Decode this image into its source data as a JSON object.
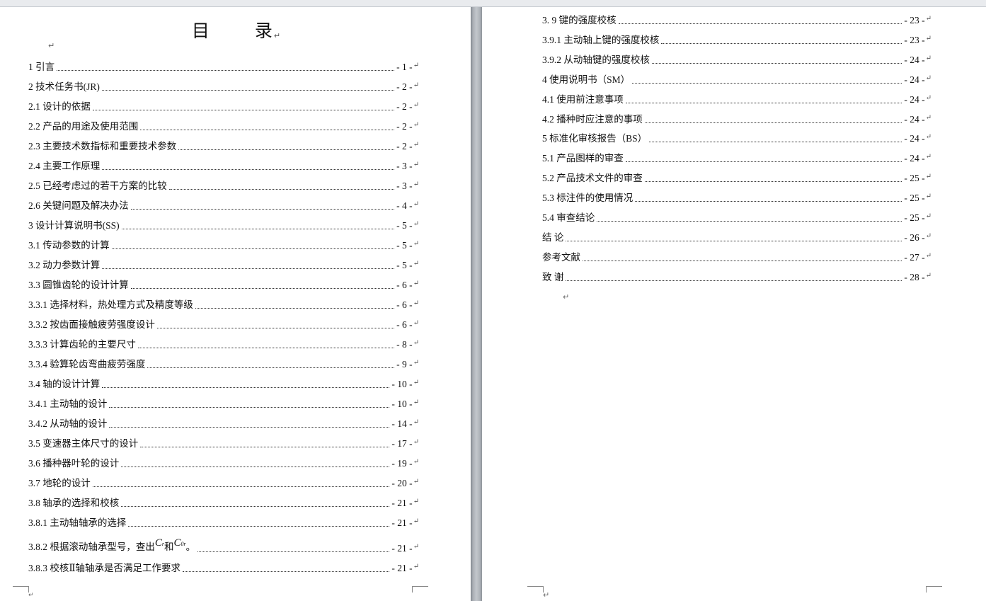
{
  "left_page": {
    "title": "目 录",
    "entries": [
      {
        "label": "1  引言",
        "page": "- 1 -"
      },
      {
        "label": "2  技术任务书(JR)",
        "page": "- 2 -"
      },
      {
        "label": "2.1  设计的依据",
        "page": "- 2 -"
      },
      {
        "label": "2.2  产品的用途及使用范围",
        "page": "- 2 -"
      },
      {
        "label": "2.3  主要技术数指标和重要技术参数",
        "page": "- 2 -"
      },
      {
        "label": "2.4  主要工作原理",
        "page": "- 3 -"
      },
      {
        "label": "2.5  已经考虑过的若干方案的比较",
        "page": "- 3 -"
      },
      {
        "label": "2.6  关键问题及解决办法",
        "page": "- 4 -"
      },
      {
        "label": "3  设计计算说明书(SS)",
        "page": "- 5 -"
      },
      {
        "label": "3.1  传动参数的计算",
        "page": "- 5 -"
      },
      {
        "label": "3.2  动力参数计算",
        "page": "- 5 -"
      },
      {
        "label": "3.3  圆锥齿轮的设计计算",
        "page": "- 6 -"
      },
      {
        "label": "3.3.1  选择材料，热处理方式及精度等级",
        "page": "- 6 -"
      },
      {
        "label": "3.3.2  按齿面接触疲劳强度设计",
        "page": "- 6 -"
      },
      {
        "label": "3.3.3  计算齿轮的主要尺寸",
        "page": "- 8 -"
      },
      {
        "label": "3.3.4  验算轮齿弯曲疲劳强度",
        "page": "- 9 -"
      },
      {
        "label": "3.4  轴的设计计算",
        "page": "- 10 -"
      },
      {
        "label": "3.4.1  主动轴的设计",
        "page": "- 10 -"
      },
      {
        "label": "3.4.2  从动轴的设计",
        "page": "- 14 -"
      },
      {
        "label": "3.5  变速器主体尺寸的设计",
        "page": "- 17 -"
      },
      {
        "label": "3.6  播种器叶轮的设计",
        "page": "- 19 -"
      },
      {
        "label": "3.7  地轮的设计",
        "page": "- 20 -"
      },
      {
        "label": "3.8  轴承的选择和校核",
        "page": "- 21 -"
      },
      {
        "label": "3.8.1  主动轴轴承的选择",
        "page": "- 21 -"
      }
    ],
    "entry_382": {
      "label_prefix": "3.8.2  根据滚动轴承型号，查出",
      "sym1": "C",
      "sym1_sub": "r",
      "mid": "和",
      "sym2": "C",
      "sym2_sub": "0r",
      "suffix": "。",
      "page": "- 21 -"
    },
    "entry_383": {
      "label": "3.8.3  校核Ⅱ轴轴承是否满足工作要求",
      "page": "- 21 -"
    }
  },
  "right_page": {
    "entries": [
      {
        "label": "3. 9  键的强度校核",
        "page": "- 23 -"
      },
      {
        "label": "3.9.1  主动轴上键的强度校核",
        "page": "- 23 -"
      },
      {
        "label": "3.9.2  从动轴键的强度校核",
        "page": "- 24 -"
      },
      {
        "label": "4  使用说明书（SM）",
        "page": "- 24 -"
      },
      {
        "label": "4.1  使用前注意事项",
        "page": "- 24 -"
      },
      {
        "label": "4.2  播种时应注意的事项",
        "page": "- 24 -"
      },
      {
        "label": "5  标准化审核报告（BS）",
        "page": "- 24 -"
      },
      {
        "label": "5.1  产品图样的审查",
        "page": "- 24 -"
      },
      {
        "label": "5.2  产品技术文件的审查",
        "page": "- 25 -"
      },
      {
        "label": "5.3  标注件的使用情况",
        "page": "- 25 -"
      },
      {
        "label": "5.4  审查结论",
        "page": "- 25 -"
      },
      {
        "label": "结  论",
        "page": "- 26 -"
      },
      {
        "label": "参考文献",
        "page": "- 27 -"
      },
      {
        "label": "致    谢",
        "page": "- 28 -"
      }
    ]
  },
  "marks": {
    "return": "↵"
  }
}
